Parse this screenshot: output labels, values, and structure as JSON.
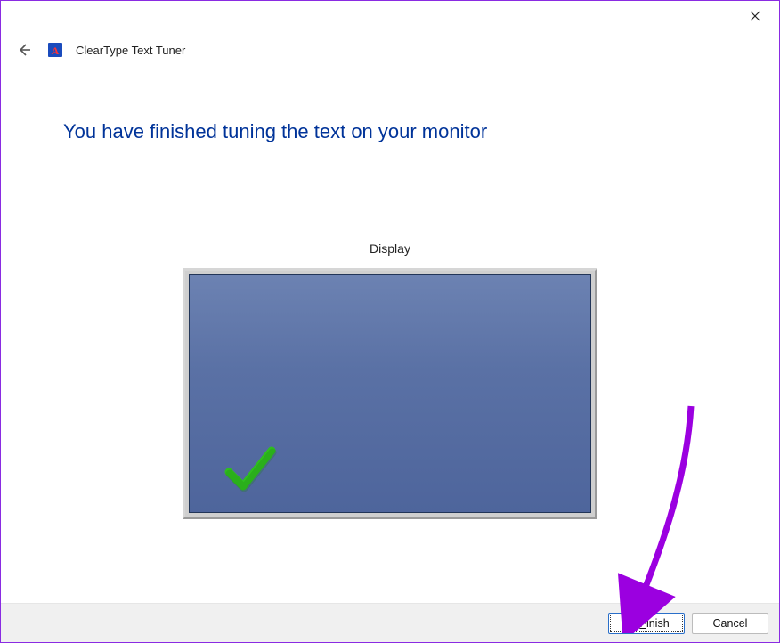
{
  "window": {
    "app_title": "ClearType Text Tuner"
  },
  "main": {
    "heading": "You have finished tuning the text on your monitor",
    "display_label": "Display"
  },
  "footer": {
    "finish_label": "Finish",
    "cancel_label": "Cancel"
  },
  "annotation": {
    "arrow_color": "#9b00e0"
  }
}
